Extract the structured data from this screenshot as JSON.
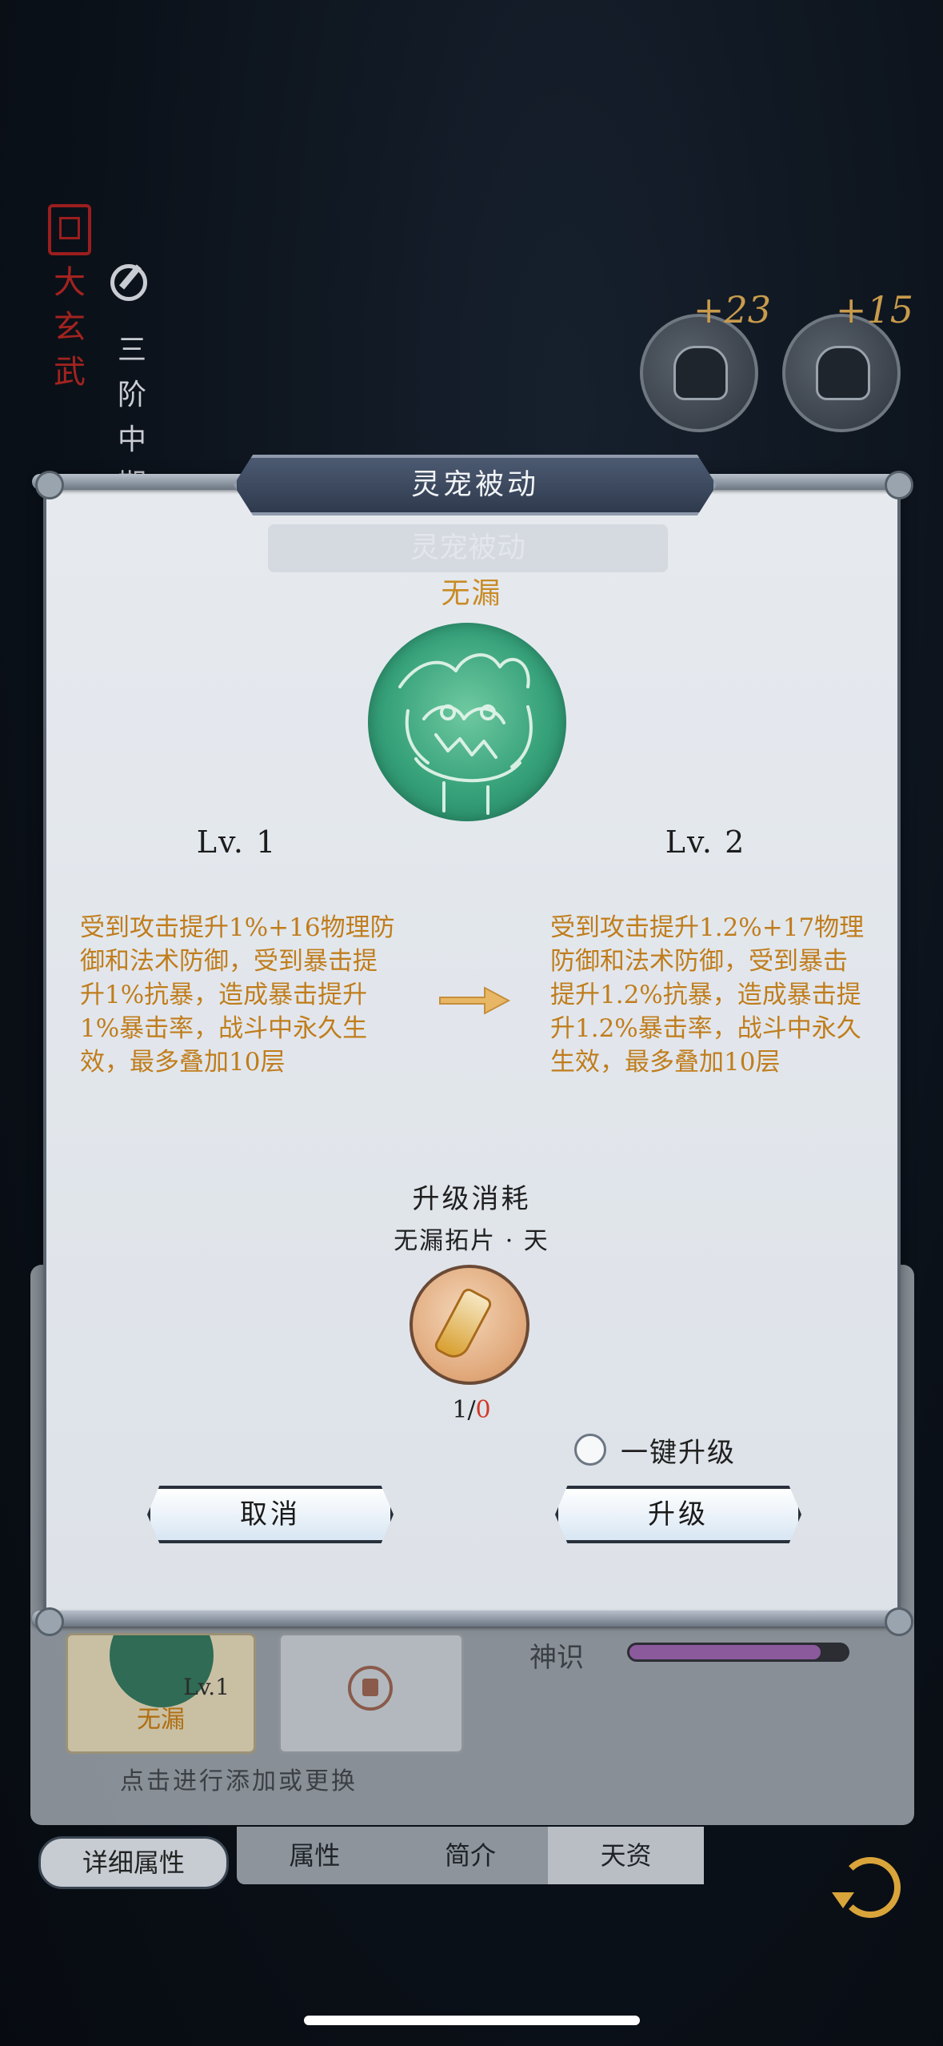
{
  "background": {
    "realm": "大玄武",
    "stage": "三阶中期",
    "equipment": [
      {
        "plus": "+23"
      },
      {
        "plus": "+15"
      }
    ],
    "pet_slot": {
      "level": "Lv.1",
      "name": "无漏"
    },
    "hint": "点击进行添加或更换",
    "shenshi_label": "神识",
    "shenshi_fill": 0.88,
    "detail_button": "详细属性",
    "tabs": [
      "属性",
      "简介",
      "天资"
    ],
    "active_tab": 2
  },
  "dialog": {
    "title": "灵宠被动",
    "skill_name": "无漏",
    "current": {
      "level": "Lv. 1",
      "desc": "受到攻击提升1%+16物理防御和法术防御，受到暴击提升1%抗暴，造成暴击提升1%暴击率，战斗中永久生效，最多叠加10层"
    },
    "next": {
      "level": "Lv. 2",
      "desc": "受到攻击提升1.2%+17物理防御和法术防御，受到暴击提升1.2%抗暴，造成暴击提升1.2%暴击率，战斗中永久生效，最多叠加10层"
    },
    "cost_title": "升级消耗",
    "cost_item": "无漏拓片 · 天",
    "count_have": "1",
    "count_sep": "/",
    "count_need": "0",
    "one_key_label": "一键升级",
    "cancel_label": "取消",
    "upgrade_label": "升级"
  },
  "colors": {
    "desc_text": "#c07d1c",
    "skill_name": "#c98b25",
    "insufficient": "#d23a2a",
    "skill_orb": "#36a17a"
  }
}
